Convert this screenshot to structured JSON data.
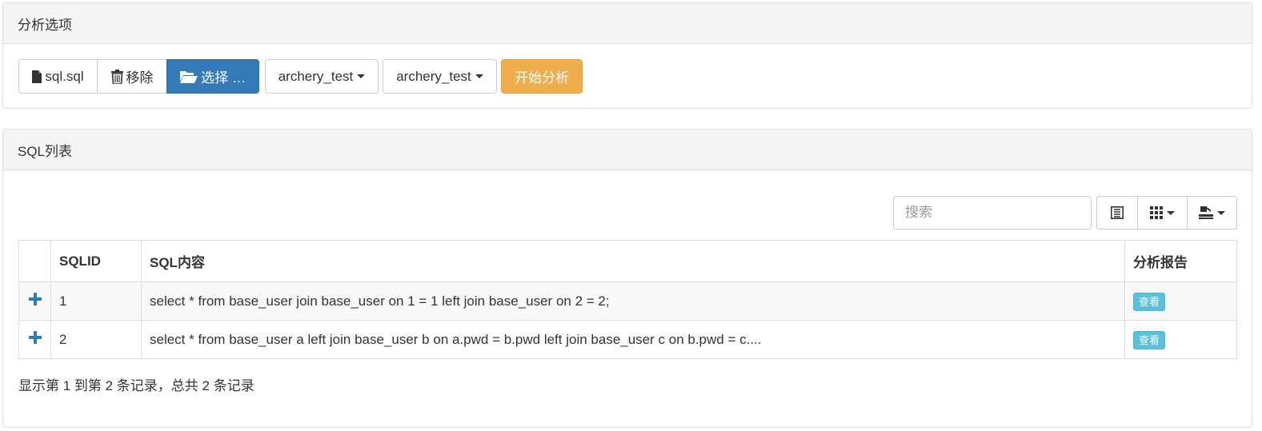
{
  "options_panel": {
    "title": "分析选项",
    "file_name": "sql.sql",
    "remove_label": "移除",
    "choose_label": "选择 …",
    "instance_select": "archery_test",
    "db_select": "archery_test",
    "start_label": "开始分析"
  },
  "sql_panel": {
    "title": "SQL列表",
    "search_placeholder": "搜索",
    "columns": [
      "SQLID",
      "SQL内容",
      "分析报告"
    ],
    "rows": [
      {
        "expand": "+",
        "sqlid": "1",
        "sql": "select * from base_user join base_user on 1 = 1 left join base_user on 2 = 2;",
        "report": "查看"
      },
      {
        "expand": "+",
        "sqlid": "2",
        "sql": "select * from base_user a left join base_user b on a.pwd = b.pwd left join base_user c on b.pwd = c....",
        "report": "查看"
      }
    ],
    "pagination_info": "显示第 1 到第 2 条记录，总共 2 条记录"
  },
  "colors": {
    "primary": "#337ab7",
    "warning": "#f0ad4e",
    "info": "#5bc0de"
  }
}
